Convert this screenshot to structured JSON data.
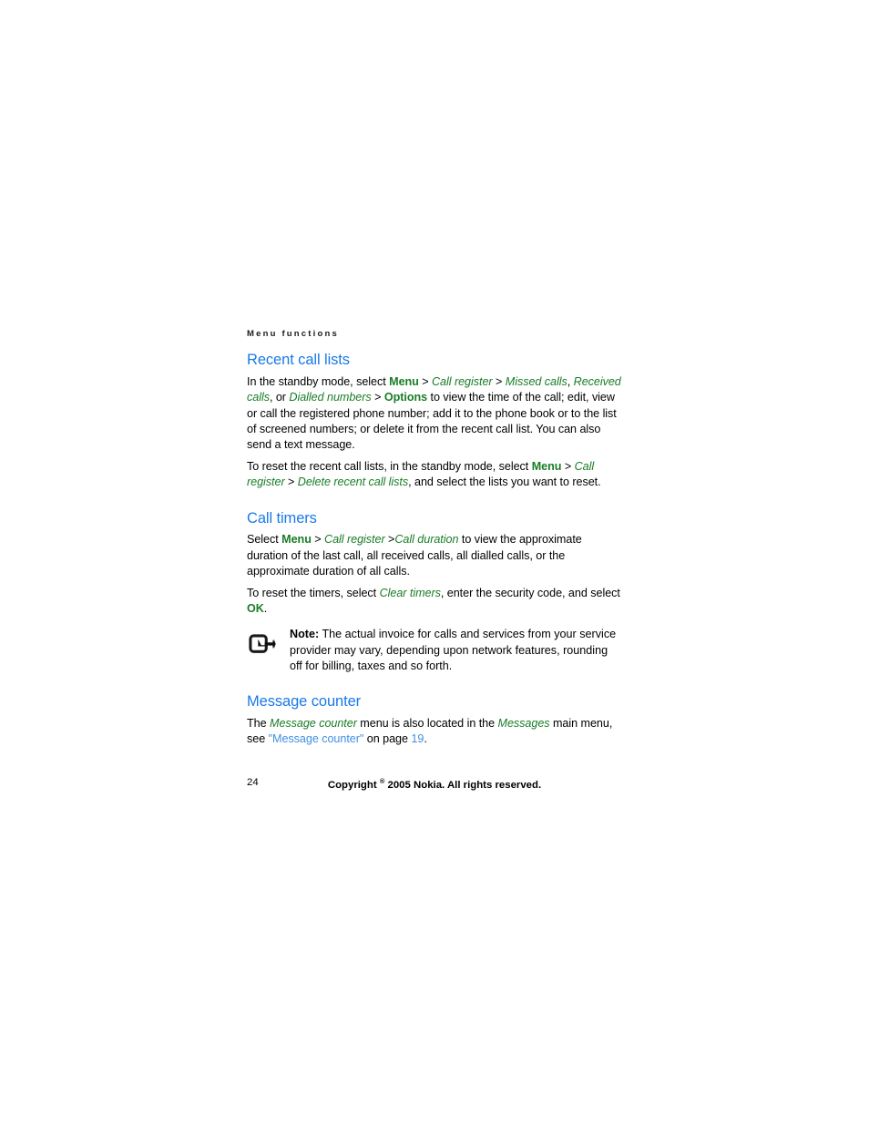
{
  "document": {
    "running_header": "Menu functions",
    "page_number": "24",
    "copyright": {
      "prefix": "Copyright",
      "symbol": "®",
      "suffix": "2005 Nokia. All rights reserved."
    }
  },
  "colors": {
    "heading_blue": "#1a7ae8",
    "ui_green": "#187d26",
    "link_blue": "#3f8fe0",
    "body_black": "#000000"
  },
  "sections": {
    "recent_call_lists": {
      "heading": "Recent call lists",
      "p1": {
        "t1": "In the standby mode, select ",
        "k1": "Menu",
        "s1": " > ",
        "i1": "Call register",
        "s2": " > ",
        "i2": "Missed calls",
        "t2": ", ",
        "i3": "Received calls",
        "t3": ", or ",
        "i4": "Dialled numbers",
        "s3": " > ",
        "k2": "Options",
        "t4": " to view the time of the call; edit, view or call the registered phone number; add it to the phone book or to the list of screened numbers; or delete it from the recent call list. You can also send a text message."
      },
      "p2": {
        "t1": "To reset the recent call lists, in the standby mode, select ",
        "k1": "Menu",
        "s1": " > ",
        "i1": "Call register",
        "s2": " > ",
        "i2": "Delete recent call lists",
        "t2": ", and select the lists you want to reset."
      }
    },
    "call_timers": {
      "heading": "Call timers",
      "p1": {
        "t1": "Select ",
        "k1": "Menu",
        "s1": " > ",
        "i1": "Call register",
        "s2": " >",
        "i2": "Call duration",
        "t2": " to view the approximate duration of the last call, all received calls, all dialled calls, or the approximate duration of all calls."
      },
      "p2": {
        "t1": "To reset the timers, select ",
        "i1": "Clear timers",
        "t2": ", enter the security code, and select ",
        "k1": "OK",
        "t3": "."
      },
      "note": {
        "icon": "note-pointer-icon",
        "label": "Note:",
        "text": " The actual invoice for calls and services from your service provider may vary, depending upon network features, rounding off for billing, taxes and so forth."
      }
    },
    "message_counter": {
      "heading": "Message counter",
      "p1": {
        "t1": "The ",
        "i1": "Message counter",
        "t2": " menu is also located in the ",
        "i2": "Messages",
        "t3": " main menu, see ",
        "link_open_quote": "\"",
        "link": "Message counter",
        "link_close_quote": "\"",
        "t4": " on page ",
        "page_ref": "19",
        "t5": "."
      }
    }
  }
}
